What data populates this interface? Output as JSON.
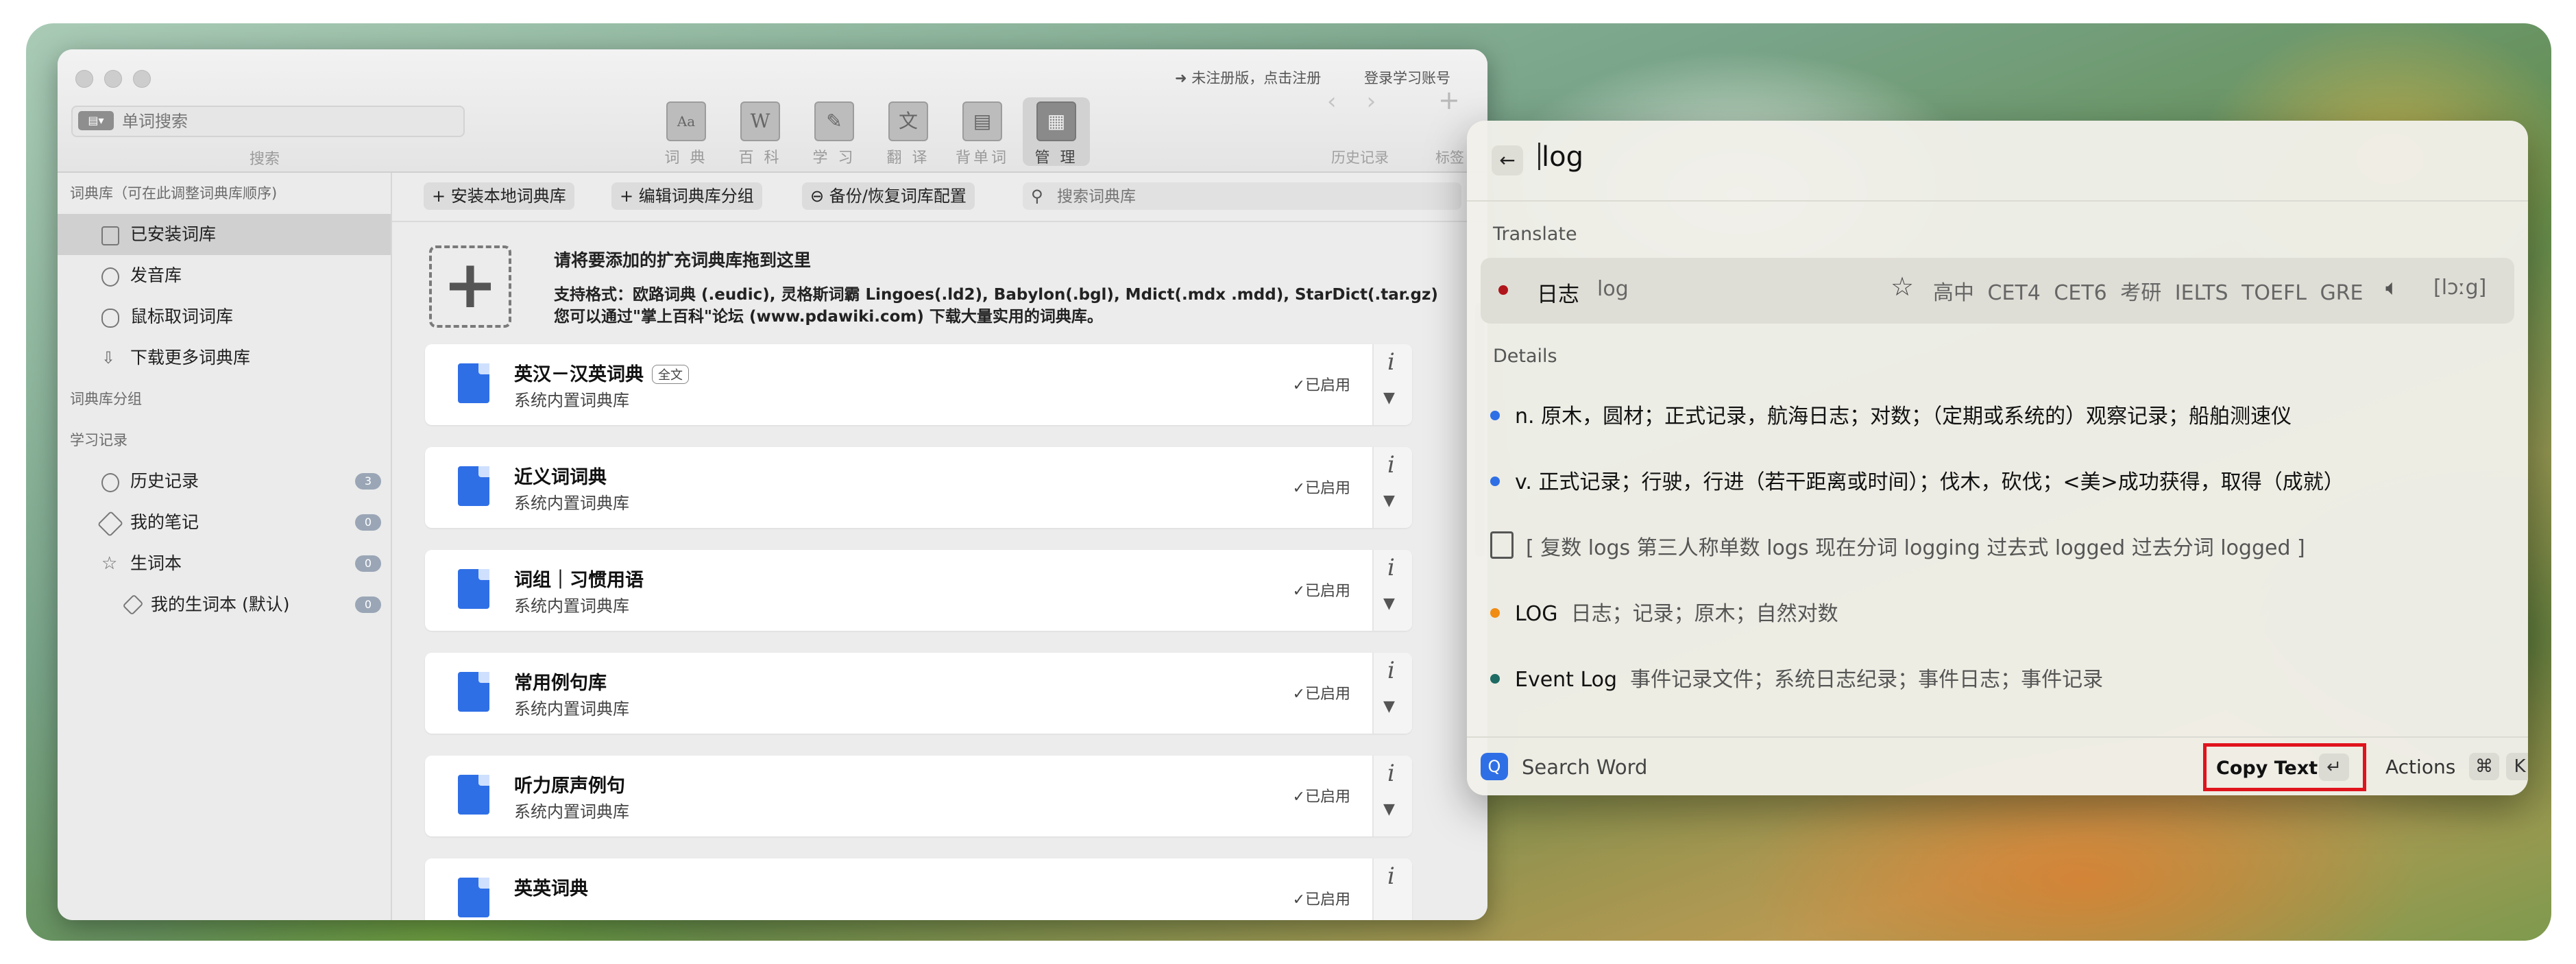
{
  "dict_window": {
    "search_placeholder": "单词搜索",
    "search_caption": "搜索",
    "register_link": "➜ 未注册版，点击注册",
    "login_link": "登录学习账号",
    "tools": [
      {
        "label": "词 典",
        "glyph": "Aa"
      },
      {
        "label": "百 科",
        "glyph": "W"
      },
      {
        "label": "学 习",
        "glyph": "✎"
      },
      {
        "label": "翻 译",
        "glyph": "文"
      },
      {
        "label": "背单词",
        "glyph": "▤"
      },
      {
        "label": "管 理",
        "glyph": "▦"
      }
    ],
    "history_label": "历史记录",
    "tag_label": "标签",
    "sidebar": {
      "head_library": "词典库（可在此调整词典库顺序)",
      "items_library": [
        "已安装词库",
        "发音库",
        "鼠标取词词库",
        "下载更多词典库"
      ],
      "head_groups": "词典库分组",
      "head_study": "学习记录",
      "items_study": [
        {
          "label": "历史记录",
          "count": "3"
        },
        {
          "label": "我的笔记",
          "count": "0"
        },
        {
          "label": "生词本",
          "count": "0"
        }
      ],
      "sub_item": {
        "label": "我的生词本 (默认)",
        "count": "0"
      }
    },
    "actions": {
      "install": "+ 安装本地词典库",
      "edit_groups": "+ 编辑词典库分组",
      "backup": "⊖ 备份/恢复词库配置",
      "search_placeholder": "搜索词典库"
    },
    "drop": {
      "title": "请将要添加的扩充词典库拖到这里",
      "line1": "支持格式：欧路词典 (.eudic), 灵格斯词霸 Lingoes(.ld2), Babylon(.bgl), Mdict(.mdx .mdd), StarDict(.tar.gz)",
      "line2": "您可以通过\"掌上百科\"论坛 (www.pdawiki.com) 下载大量实用的词典库。"
    },
    "dictionaries": [
      {
        "name": "英汉－汉英词典",
        "tag": "全文",
        "desc": "系统内置词典库",
        "status": "✓已启用"
      },
      {
        "name": "近义词词典",
        "tag": "",
        "desc": "系统内置词典库",
        "status": "✓已启用"
      },
      {
        "name": "词组｜习惯用语",
        "tag": "",
        "desc": "系统内置词典库",
        "status": "✓已启用"
      },
      {
        "name": "常用例句库",
        "tag": "",
        "desc": "系统内置词典库",
        "status": "✓已启用"
      },
      {
        "name": "听力原声例句",
        "tag": "",
        "desc": "系统内置词典库",
        "status": "✓已启用"
      },
      {
        "name": "英英词典",
        "tag": "",
        "desc": "",
        "status": "✓已启用"
      }
    ]
  },
  "palette": {
    "query": "log",
    "translate_label": "Translate",
    "result": {
      "word": "日志",
      "sub": "log",
      "tags": "高中 CET4 CET6 考研 IELTS TOEFL GRE",
      "phonetic": "[lɔːg]",
      "dot_color": "#b0151b"
    },
    "details_label": "Details",
    "definitions": [
      {
        "text": "n. 原木，圆材；正式记录，航海日志；对数；（定期或系统的）观察记录；船舶测速仪",
        "dot": "#2f6fe6"
      },
      {
        "text": "v. 正式记录；行驶，行进（若干距离或时间）；伐木，砍伐；<美>成功获得，取得（成就）",
        "dot": "#2f6fe6"
      }
    ],
    "forms": "[ 复数 logs   第三人称单数 logs   现在分词 logging   过去式 logged   过去分词 logged ]",
    "related": [
      {
        "word": "LOG",
        "meaning": "日志；记录；原木；自然对数",
        "dot": "#f08c14"
      },
      {
        "word": "Event Log",
        "meaning": "事件记录文件；系统日志纪录；事件日志；事件记录",
        "dot": "#1d6b62"
      }
    ],
    "footer": {
      "search_word": "Search Word",
      "copy_text": "Copy Text",
      "enter_key": "↵",
      "actions": "Actions",
      "cmd_key": "⌘",
      "k_key": "K"
    }
  }
}
